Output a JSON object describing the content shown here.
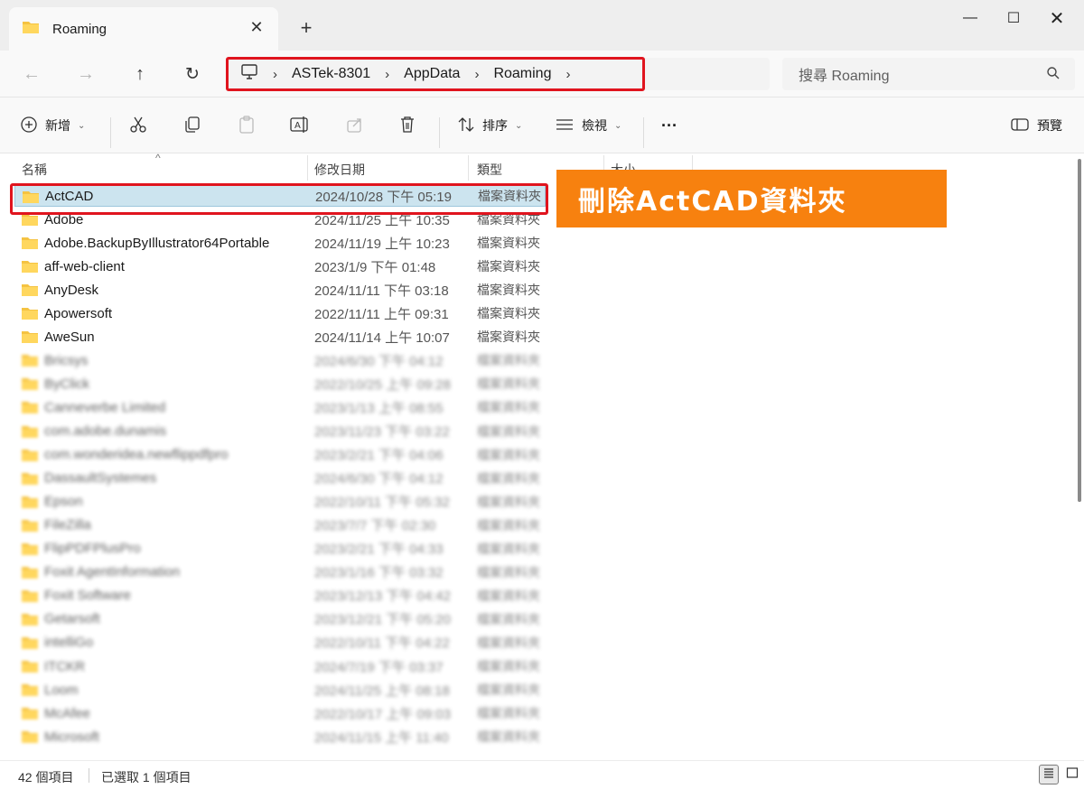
{
  "window": {
    "tab_title": "Roaming",
    "tab_close": "✕",
    "new_tab": "+",
    "minimize": "—",
    "maximize": "☐",
    "close": "✕"
  },
  "nav": {
    "back": "←",
    "forward": "→",
    "up": "↑",
    "refresh": "↻",
    "breadcrumb": [
      "ASTek-8301",
      "AppData",
      "Roaming"
    ],
    "breadcrumb_sep": "›",
    "search_placeholder": "搜尋 Roaming"
  },
  "commands": {
    "new_label": "新增",
    "sort_label": "排序",
    "view_label": "檢視",
    "more": "···",
    "preview_label": "預覽"
  },
  "columns": {
    "name": "名稱",
    "modified": "修改日期",
    "type": "類型",
    "size": "大小"
  },
  "files": [
    {
      "name": "ActCAD",
      "date": "2024/10/28 下午 05:19",
      "type": "檔案資料夾",
      "selected": true
    },
    {
      "name": "Adobe",
      "date": "2024/11/25 上午 10:35",
      "type": "檔案資料夾"
    },
    {
      "name": "Adobe.BackupByIllustrator64Portable",
      "date": "2024/11/19 上午 10:23",
      "type": "檔案資料夾"
    },
    {
      "name": "aff-web-client",
      "date": "2023/1/9 下午 01:48",
      "type": "檔案資料夾"
    },
    {
      "name": "AnyDesk",
      "date": "2024/11/11 下午 03:18",
      "type": "檔案資料夾"
    },
    {
      "name": "Apowersoft",
      "date": "2022/11/11 上午 09:31",
      "type": "檔案資料夾"
    },
    {
      "name": "AweSun",
      "date": "2024/11/14 上午 10:07",
      "type": "檔案資料夾"
    },
    {
      "name": "Bricsys",
      "date": "2024/6/30 下午 04:12",
      "type": "檔案資料夾",
      "blurred": true
    },
    {
      "name": "ByClick",
      "date": "2022/10/25 上午 09:28",
      "type": "檔案資料夾",
      "blurred": true
    },
    {
      "name": "Canneverbe Limited",
      "date": "2023/1/13 上午 08:55",
      "type": "檔案資料夾",
      "blurred": true
    },
    {
      "name": "com.adobe.dunamis",
      "date": "2023/11/23 下午 03:22",
      "type": "檔案資料夾",
      "blurred": true
    },
    {
      "name": "com.wonderidea.newflippdfpro",
      "date": "2023/2/21 下午 04:06",
      "type": "檔案資料夾",
      "blurred": true
    },
    {
      "name": "DassaultSystemes",
      "date": "2024/6/30 下午 04:12",
      "type": "檔案資料夾",
      "blurred": true
    },
    {
      "name": "Epson",
      "date": "2022/10/11 下午 05:32",
      "type": "檔案資料夾",
      "blurred": true
    },
    {
      "name": "FileZilla",
      "date": "2023/7/7 下午 02:30",
      "type": "檔案資料夾",
      "blurred": true
    },
    {
      "name": "FlipPDFPlusPro",
      "date": "2023/2/21 下午 04:33",
      "type": "檔案資料夾",
      "blurred": true
    },
    {
      "name": "Foxit AgentInformation",
      "date": "2023/1/16 下午 03:32",
      "type": "檔案資料夾",
      "blurred": true
    },
    {
      "name": "Foxit Software",
      "date": "2023/12/13 下午 04:42",
      "type": "檔案資料夾",
      "blurred": true
    },
    {
      "name": "Getarsoft",
      "date": "2023/12/21 下午 05:20",
      "type": "檔案資料夾",
      "blurred": true
    },
    {
      "name": "intelliGo",
      "date": "2022/10/11 下午 04:22",
      "type": "檔案資料夾",
      "blurred": true
    },
    {
      "name": "ITCKR",
      "date": "2024/7/19 下午 03:37",
      "type": "檔案資料夾",
      "blurred": true
    },
    {
      "name": "Loom",
      "date": "2024/11/25 上午 08:18",
      "type": "檔案資料夾",
      "blurred": true
    },
    {
      "name": "McAfee",
      "date": "2022/10/17 上午 09:03",
      "type": "檔案資料夾",
      "blurred": true
    },
    {
      "name": "Microsoft",
      "date": "2024/11/15 上午 11:40",
      "type": "檔案資料夾",
      "blurred": true
    }
  ],
  "callout": "刪除ActCAD資料夾",
  "status": {
    "item_count": "42 個項目",
    "selected": "已選取 1 個項目"
  },
  "colors": {
    "accent_red": "#e0141e",
    "callout_orange": "#f7810f",
    "folder_yellow": "#f5c342",
    "selection_blue": "#cce4ef"
  }
}
